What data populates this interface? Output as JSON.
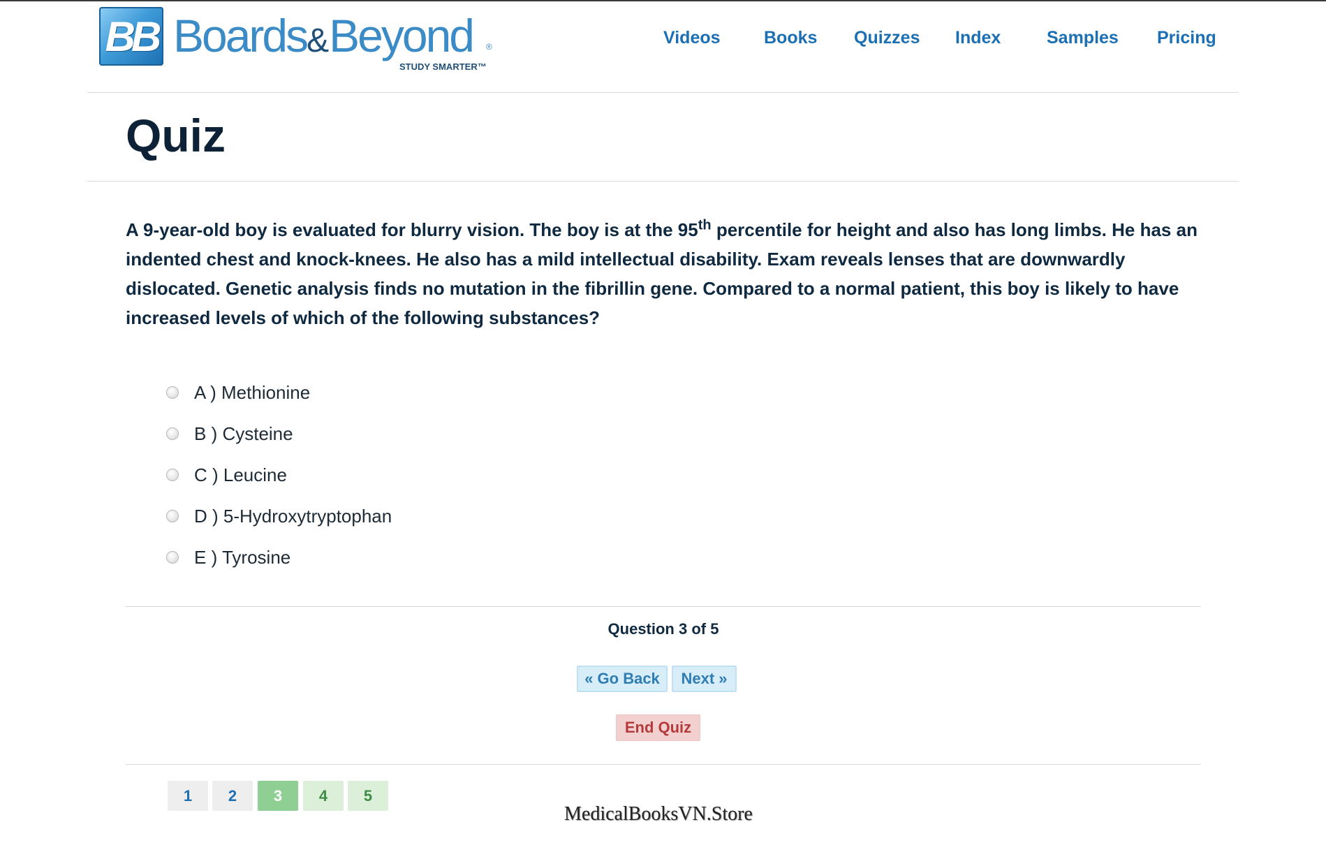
{
  "brand": {
    "logo_mark": "BB",
    "name_part1": "Boards",
    "name_amp": "&",
    "name_part2": "Beyond",
    "registered": "®",
    "tagline": "STUDY SMARTER™",
    "accent_color": "#1b6fb2"
  },
  "nav": {
    "items": [
      {
        "label": "Videos"
      },
      {
        "label": "Books"
      },
      {
        "label": "Quizzes"
      },
      {
        "label": "Index"
      },
      {
        "label": "Samples"
      },
      {
        "label": "Pricing"
      }
    ]
  },
  "page": {
    "title": "Quiz"
  },
  "question": {
    "text_before": "A 9-year-old boy is evaluated for blurry vision. The boy is at the 95",
    "superscript": "th",
    "text_after": " percentile for height and also has long limbs. He has an indented chest and knock-knees. He also has a mild intellectual disability. Exam reveals lenses that are downwardly dislocated. Genetic analysis finds no mutation in the fibrillin gene. Compared to a normal patient, this boy is likely to have increased levels of which of the following substances?"
  },
  "options": [
    {
      "label": "A ) Methionine",
      "selected": false
    },
    {
      "label": "B ) Cysteine",
      "selected": false
    },
    {
      "label": "C ) Leucine",
      "selected": false
    },
    {
      "label": "D ) 5-Hydroxytryptophan",
      "selected": false
    },
    {
      "label": "E ) Tyrosine",
      "selected": false
    }
  ],
  "progress": {
    "text": "Question 3 of 5",
    "current": 3,
    "total": 5
  },
  "buttons": {
    "back": "« Go Back",
    "next": "Next »",
    "end": "End Quiz"
  },
  "pager": {
    "pages": [
      {
        "label": "1",
        "state": "visited"
      },
      {
        "label": "2",
        "state": "visited"
      },
      {
        "label": "3",
        "state": "current"
      },
      {
        "label": "4",
        "state": "pending"
      },
      {
        "label": "5",
        "state": "pending"
      }
    ]
  },
  "watermark": "MedicalBooksVN.Store"
}
